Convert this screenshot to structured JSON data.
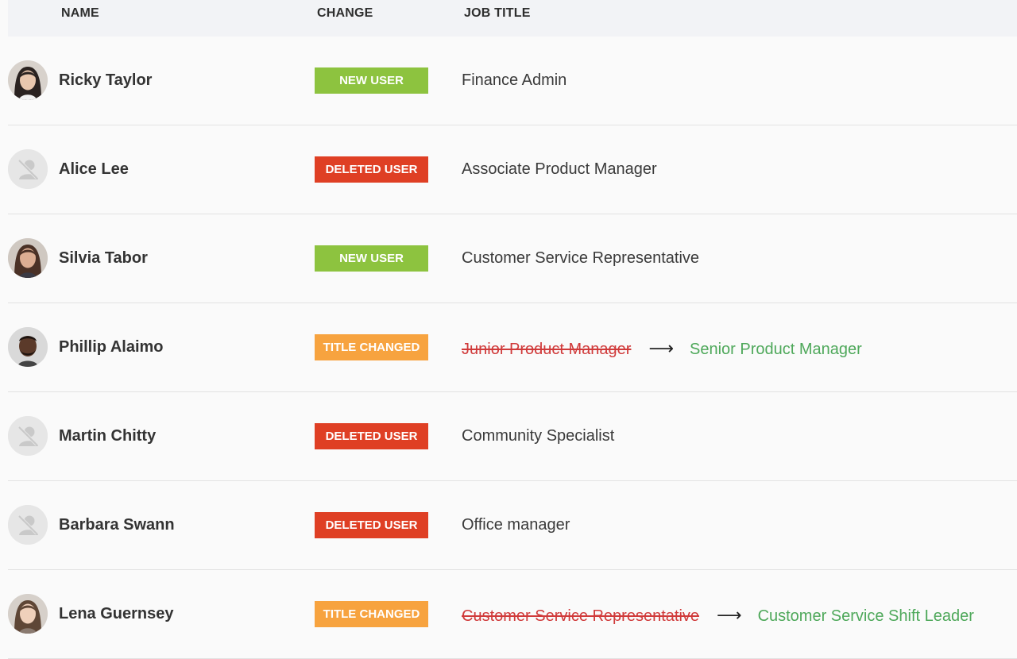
{
  "header": {
    "name_label": "NAME",
    "change_label": "CHANGE",
    "job_label": "JOB TITLE"
  },
  "colors": {
    "new_user": "#8dc33f",
    "deleted_user": "#df3f24",
    "title_changed": "#f7a33f",
    "old_title": "#d03a3a",
    "new_title": "#4ea85a"
  },
  "rows": [
    {
      "name": "Ricky Taylor",
      "change": "NEW USER",
      "change_type": "new",
      "avatar": "photo-woman-dark-hair",
      "job": "Finance Admin"
    },
    {
      "name": "Alice Lee",
      "change": "DELETED USER",
      "change_type": "deleted",
      "avatar": "deleted-user-icon",
      "job": "Associate Product Manager"
    },
    {
      "name": "Silvia Tabor",
      "change": "NEW USER",
      "change_type": "new",
      "avatar": "photo-woman-brown-hair",
      "job": "Customer Service Representative"
    },
    {
      "name": "Phillip Alaimo",
      "change": "TITLE CHANGED",
      "change_type": "title",
      "avatar": "photo-man-beard",
      "old_job": "Junior Product Manager",
      "arrow": "⟶",
      "new_job": "Senior Product Manager"
    },
    {
      "name": "Martin Chitty",
      "change": "DELETED USER",
      "change_type": "deleted",
      "avatar": "deleted-user-icon",
      "job": "Community Specialist"
    },
    {
      "name": "Barbara Swann",
      "change": "DELETED USER",
      "change_type": "deleted",
      "avatar": "deleted-user-icon",
      "job": "Office manager"
    },
    {
      "name": "Lena Guernsey",
      "change": "TITLE CHANGED",
      "change_type": "title",
      "avatar": "photo-woman-light-hair",
      "old_job": "Customer Service Representative",
      "arrow": "⟶",
      "new_job": "Customer Service Shift Leader"
    }
  ]
}
